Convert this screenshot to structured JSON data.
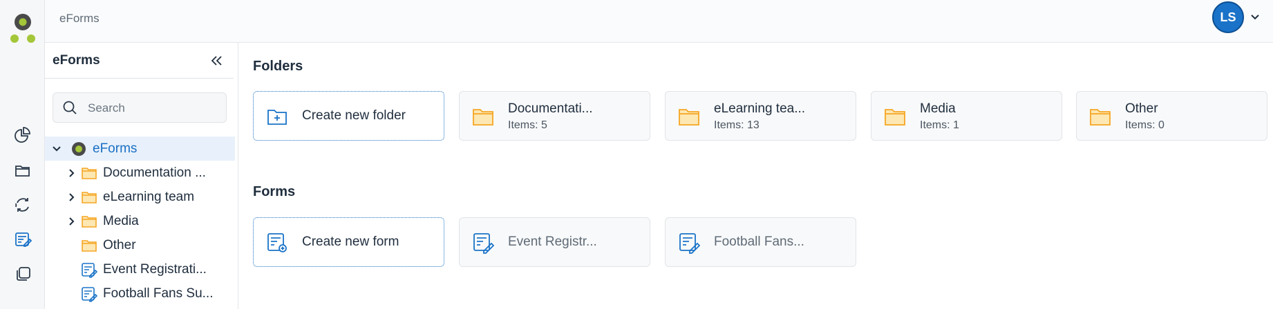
{
  "app": {
    "title": "eForms",
    "user_initials": "LS"
  },
  "colors": {
    "accent": "#1a73c8",
    "folder": "#f5a623",
    "logo_green": "#a4c639",
    "logo_dark": "#4a4a4a"
  },
  "rail": {
    "items": [
      {
        "icon": "analytics-icon"
      },
      {
        "icon": "folder-icon"
      },
      {
        "icon": "sync-icon"
      },
      {
        "icon": "eforms-icon",
        "active": true
      },
      {
        "icon": "copy-icon"
      }
    ]
  },
  "tree": {
    "title": "eForms",
    "search_placeholder": "Search",
    "root": {
      "label": "eForms"
    },
    "items": [
      {
        "label": "Documentation ...",
        "type": "folder",
        "expandable": true
      },
      {
        "label": "eLearning team",
        "type": "folder",
        "expandable": true
      },
      {
        "label": "Media",
        "type": "folder",
        "expandable": true
      },
      {
        "label": "Other",
        "type": "folder",
        "expandable": false
      },
      {
        "label": "Event Registrati...",
        "type": "form",
        "expandable": false
      },
      {
        "label": "Football Fans Su...",
        "type": "form",
        "expandable": false
      }
    ]
  },
  "main": {
    "folders_title": "Folders",
    "create_folder_label": "Create new folder",
    "folders": [
      {
        "name": "Documentati...",
        "count": "Items: 5"
      },
      {
        "name": "eLearning tea...",
        "count": "Items: 13"
      },
      {
        "name": "Media",
        "count": "Items: 1"
      },
      {
        "name": "Other",
        "count": "Items: 0"
      }
    ],
    "forms_title": "Forms",
    "create_form_label": "Create new form",
    "forms": [
      {
        "name": "Event Registr..."
      },
      {
        "name": "Football Fans..."
      }
    ]
  }
}
